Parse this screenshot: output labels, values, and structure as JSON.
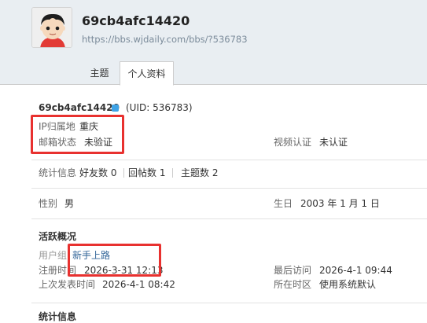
{
  "header": {
    "username": "69cb4afc14420",
    "url": "https://bbs.wjdaily.com/bbs/?536783"
  },
  "tabs": [
    {
      "label": "主题"
    },
    {
      "label": "个人资料"
    }
  ],
  "profile": {
    "name": "69cb4afc14420",
    "uid": "(UID: 536783)",
    "ip_label": "IP归属地",
    "ip_value": "重庆",
    "email_label": "邮箱状态",
    "email_value": "未验证",
    "video_label": "视频认证",
    "video_value": "未认证",
    "stats_label": "统计信息",
    "friends": "好友数 0",
    "replies": "回帖数 1",
    "topics": "主题数 2",
    "gender_label": "性别",
    "gender_value": "男",
    "birthday_label": "生日",
    "birthday_value": "2003 年 1 月 1 日"
  },
  "activity": {
    "heading": "活跃概况",
    "group_label": "用户组",
    "group_value": "新手上路",
    "reg_label": "注册时间",
    "reg_value": "2026-3-31 12:13",
    "last_visit_label": "最后访问",
    "last_visit_value": "2026-4-1 09:44",
    "last_post_label": "上次发表时间",
    "last_post_value": "2026-4-1 08:42",
    "timezone_label": "所在时区",
    "timezone_value": "使用系统默认"
  },
  "footer_heading": "统计信息",
  "icons": {
    "avatar": "cartoon-boy-avatar",
    "verify_badge": "blue-square-badge"
  },
  "colors": {
    "header_bg": "#e9eef2",
    "link": "#336699",
    "highlight": "#e8312f",
    "badge": "#3fa3e6"
  }
}
